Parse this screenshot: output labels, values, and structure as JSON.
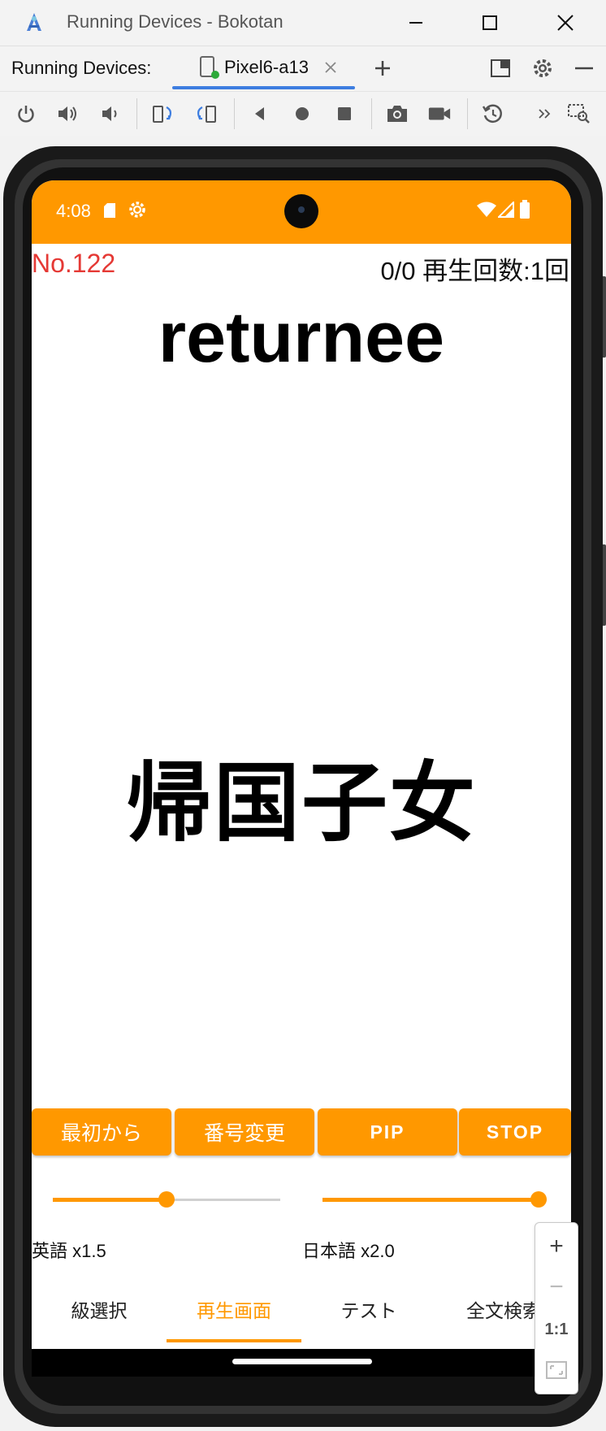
{
  "window": {
    "title": "Running Devices - Bokotan",
    "minimize_icon": "minimize-icon",
    "maximize_icon": "maximize-icon",
    "close_icon": "close-icon"
  },
  "tabbar": {
    "label": "Running Devices:",
    "device_tab": "Pixel6-a13",
    "add_icon": "plus-icon",
    "settings_icon": "gear-icon"
  },
  "toolbar": {
    "icons": [
      "power-icon",
      "volume-up-icon",
      "volume-down-icon",
      "rotate-left-icon",
      "rotate-right-icon",
      "back-icon",
      "home-icon",
      "overview-icon",
      "camera-icon",
      "screenrecord-icon",
      "reset-icon",
      "more-icon",
      "inspect-icon"
    ]
  },
  "status": {
    "time": "4:08"
  },
  "app": {
    "number": "No.122",
    "counter": "0/0 再生回数:1回",
    "word_en": "returnee",
    "word_ja": "帰国子女",
    "buttons": [
      "最初から",
      "番号変更",
      "PIP",
      "STOP"
    ],
    "speed_en_label": "英語 x1.5",
    "speed_ja_label": "日本語 x2.0",
    "speed_en_value": 0.5,
    "speed_ja_value": 1.0,
    "nav": [
      "級選択",
      "再生画面",
      "テスト",
      "全文検索"
    ],
    "nav_active": "再生画面"
  },
  "zoom": {
    "zoom_in": "+",
    "zoom_out": "−",
    "ratio": "1:1"
  },
  "colors": {
    "accent": "#ff9800",
    "number_red": "#e53935",
    "tab_underline": "#3d7de0"
  }
}
